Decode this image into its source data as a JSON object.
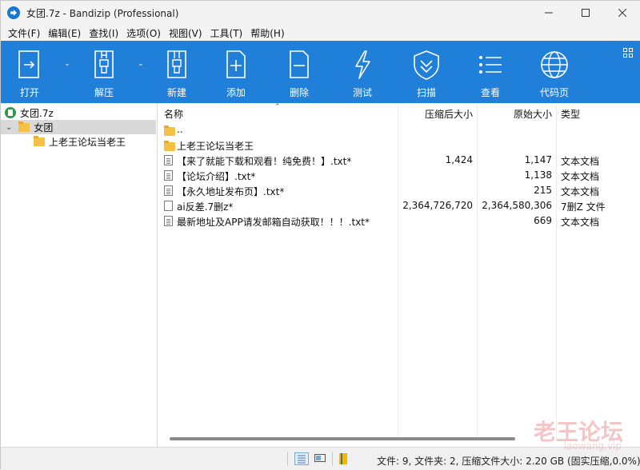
{
  "window": {
    "title": "女团.7z - Bandizip (Professional)",
    "controls": {
      "minimize": "—",
      "maximize": "☐",
      "close": "✕"
    }
  },
  "menu": [
    "文件(F)",
    "编辑(E)",
    "查找(I)",
    "选项(O)",
    "视图(V)",
    "工具(T)",
    "帮助(H)"
  ],
  "toolbar": {
    "accent": "#1f7fd9",
    "buttons": [
      {
        "label": "打开",
        "icon": "open-icon"
      },
      {
        "label": "解压",
        "icon": "extract-icon"
      },
      {
        "label": "新建",
        "icon": "new-archive-icon"
      },
      {
        "label": "添加",
        "icon": "add-file-icon"
      },
      {
        "label": "删除",
        "icon": "delete-file-icon"
      },
      {
        "label": "测试",
        "icon": "test-icon"
      },
      {
        "label": "扫描",
        "icon": "scan-icon"
      },
      {
        "label": "查看",
        "icon": "view-list-icon"
      },
      {
        "label": "代码页",
        "icon": "codepage-icon"
      }
    ]
  },
  "tree": {
    "root": "女团.7z",
    "folder": "女团",
    "subfolder": "上老王论坛当老王"
  },
  "list": {
    "headers": {
      "name": "名称",
      "compressed": "压缩后大小",
      "original": "原始大小",
      "type": "类型"
    },
    "rows": [
      {
        "name": "..",
        "compressed": "",
        "original": "",
        "type": "",
        "icon": "folder-icon"
      },
      {
        "name": "上老王论坛当老王",
        "compressed": "",
        "original": "",
        "type": "",
        "icon": "folder-icon"
      },
      {
        "name": "【来了就能下载和观看！纯免费！】.txt*",
        "compressed": "1,424",
        "original": "1,147",
        "type": "文本文档",
        "icon": "text-file-icon"
      },
      {
        "name": "【论坛介绍】.txt*",
        "compressed": "",
        "original": "1,138",
        "type": "文本文档",
        "icon": "text-file-icon"
      },
      {
        "name": "【永久地址发布页】.txt*",
        "compressed": "",
        "original": "215",
        "type": "文本文档",
        "icon": "text-file-icon"
      },
      {
        "name": "ai反差.7删z*",
        "compressed": "2,364,726,720",
        "original": "2,364,580,306",
        "type": "7删Z 文件",
        "icon": "file-icon"
      },
      {
        "name": "最新地址及APP请发邮箱自动获取！！！.txt*",
        "compressed": "",
        "original": "669",
        "type": "文本文档",
        "icon": "text-file-icon"
      }
    ]
  },
  "status": {
    "text": "文件: 9, 文件夹: 2, 压缩文件大小: 2.20 GB (固实压缩,0.0%)"
  },
  "watermark": {
    "text": "老王论坛",
    "sub": "laowang.vip"
  }
}
